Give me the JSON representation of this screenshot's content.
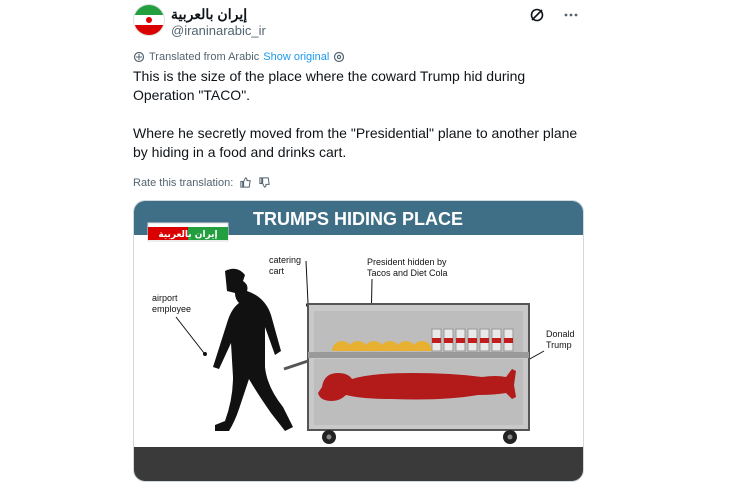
{
  "author": {
    "name": "إيران بالعربية",
    "handle": "@iraninarabic_ir"
  },
  "translation": {
    "label": "Translated from Arabic",
    "show_original": "Show original",
    "rate_label": "Rate this translation:"
  },
  "post": {
    "paragraph_1": "This is the size of the place where the coward Trump hid during Operation \"TACO\".",
    "paragraph_2": "Where he secretly moved from the \"Presidential\" plane to another plane by hiding in a food and drinks cart."
  },
  "image": {
    "title": "TRUMPS HIDING PLACE",
    "logo_text": "إيران بالعربية",
    "label_cart": "catering\ncart",
    "label_employee": "airport\nemployee",
    "label_hidden": "President hidden by\nTacos and Diet Cola",
    "label_trump": "Donald\nTrump",
    "colors": {
      "title_bar": "#3f6f86",
      "silhouette": "#111111",
      "figure": "#b31b1b",
      "cart": "#c9c9c9",
      "ground": "#3a3a3a"
    }
  }
}
